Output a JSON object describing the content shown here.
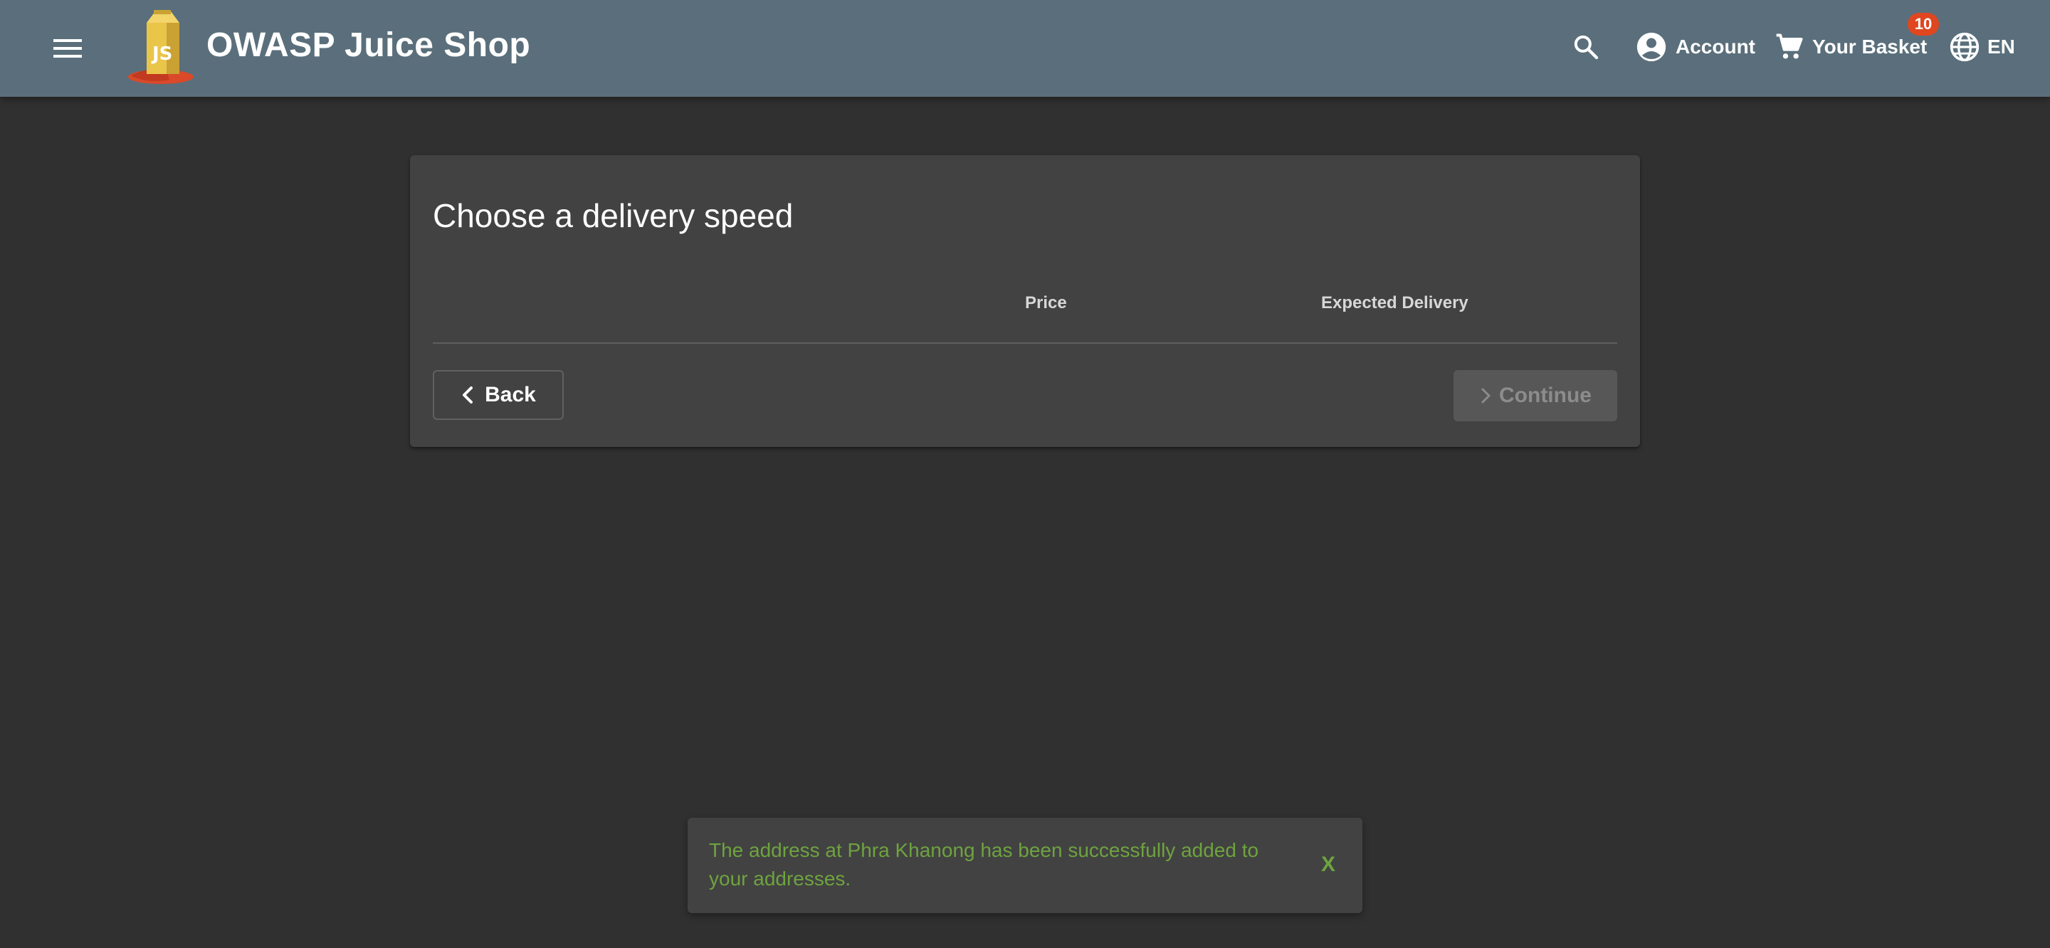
{
  "header": {
    "app_title": "OWASP Juice Shop",
    "account_label": "Account",
    "basket_label": "Your Basket",
    "basket_count": "10",
    "language_label": "EN",
    "icons": {
      "menu": "menu-icon",
      "search": "search-icon",
      "account": "account-circle-icon",
      "basket": "shopping-cart-icon",
      "language": "globe-icon"
    }
  },
  "delivery": {
    "title": "Choose a delivery speed",
    "columns": [
      "Price",
      "Expected Delivery"
    ],
    "back_label": "Back",
    "continue_label": "Continue"
  },
  "snackbar": {
    "message": "The address at Phra Khanong has been successfully added to your addresses.",
    "close_label": "X"
  },
  "colors": {
    "toolbar": "#5a6f7b",
    "background": "#303030",
    "card": "#424242",
    "badge": "#e0461f",
    "snackbar_text": "#6ea33f"
  }
}
